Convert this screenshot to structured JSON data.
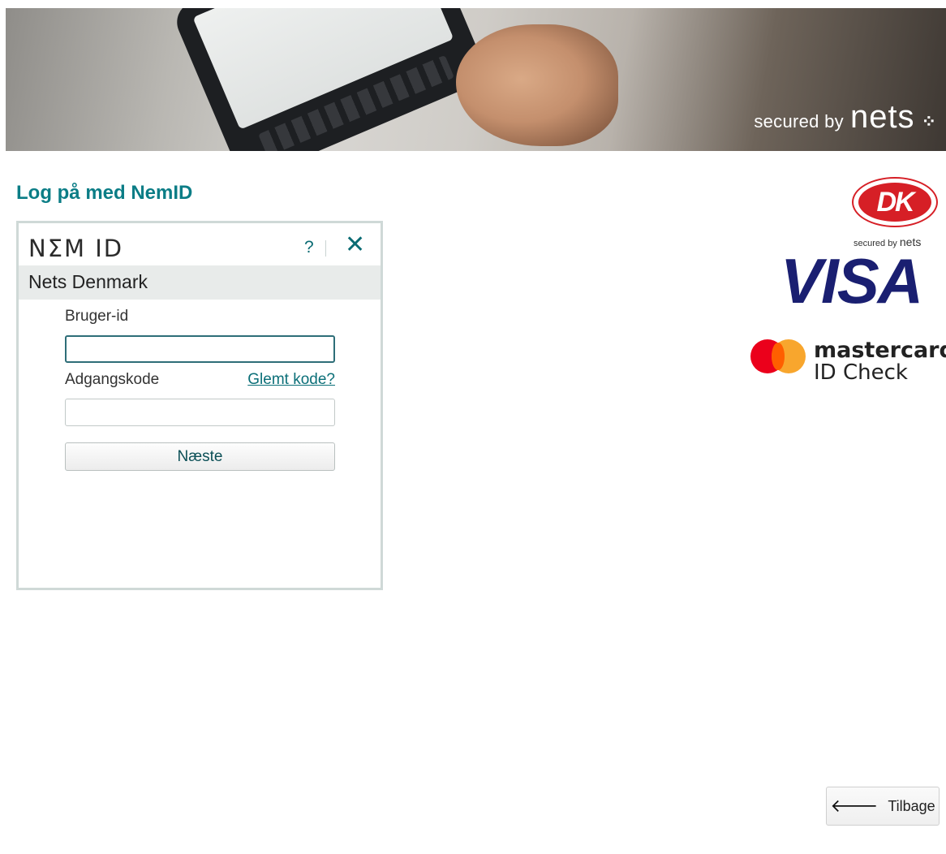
{
  "banner": {
    "secured_prefix": "secured by",
    "secured_brand": "nets",
    "secured_dots": "⁘"
  },
  "page": {
    "title": "Log på med NemID"
  },
  "nemid": {
    "logo": "NΣM ID",
    "help": "?",
    "close": "✕",
    "merchant": "Nets Denmark",
    "user_id_label": "Bruger-id",
    "user_id_value": "",
    "password_label": "Adgangskode",
    "password_value": "",
    "forgot_link": "Glemt kode?",
    "next_button": "Næste"
  },
  "logos": {
    "dk_mark": "DK",
    "dk_secured_prefix": "secured by",
    "dk_secured_brand": "nets",
    "visa": "VISA",
    "mastercard_brand": "mastercard.",
    "mastercard_sub": "ID Check",
    "colors": {
      "dk_red": "#d61f26",
      "visa_blue": "#1a1f71",
      "mc_red": "#eb001b",
      "mc_orange": "#f79e1b"
    }
  },
  "footer": {
    "back_label": "Tilbage",
    "back_icon": "arrow-left-icon"
  },
  "theme": {
    "accent": "#0b7d86"
  }
}
